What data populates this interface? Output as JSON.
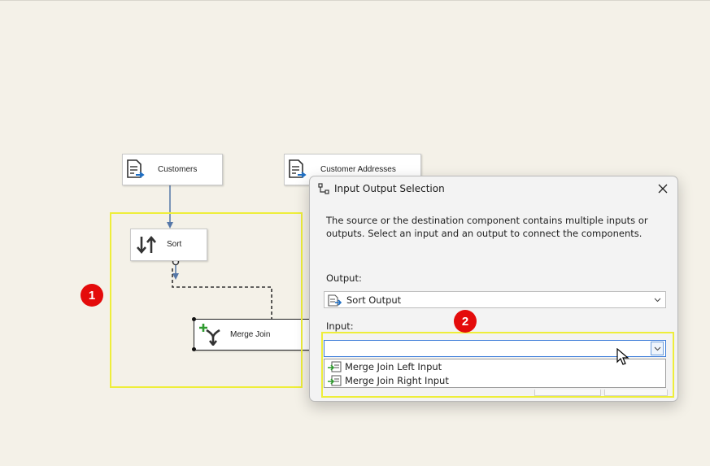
{
  "canvas": {
    "nodes": {
      "customers": {
        "label": "Customers",
        "icon": "source-file-icon"
      },
      "customer_addresses": {
        "label": "Customer Addresses",
        "icon": "source-file-icon"
      },
      "sort": {
        "label": "Sort",
        "icon": "sort-arrows-icon"
      },
      "merge_join": {
        "label": "Merge Join",
        "icon": "merge-join-icon"
      }
    }
  },
  "annotations": {
    "badge_1": "1",
    "badge_2": "2",
    "highlight_color": "#eeee3a",
    "badge_color": "#e40b0b"
  },
  "dialog": {
    "title": "Input Output Selection",
    "description": "The source or the destination component contains multiple inputs or outputs. Select an input and an output to connect the components.",
    "output_label": "Output:",
    "output_value": "Sort Output",
    "input_label": "Input:",
    "input_value": "",
    "input_options": [
      "Merge Join Left Input",
      "Merge Join Right Input"
    ]
  }
}
